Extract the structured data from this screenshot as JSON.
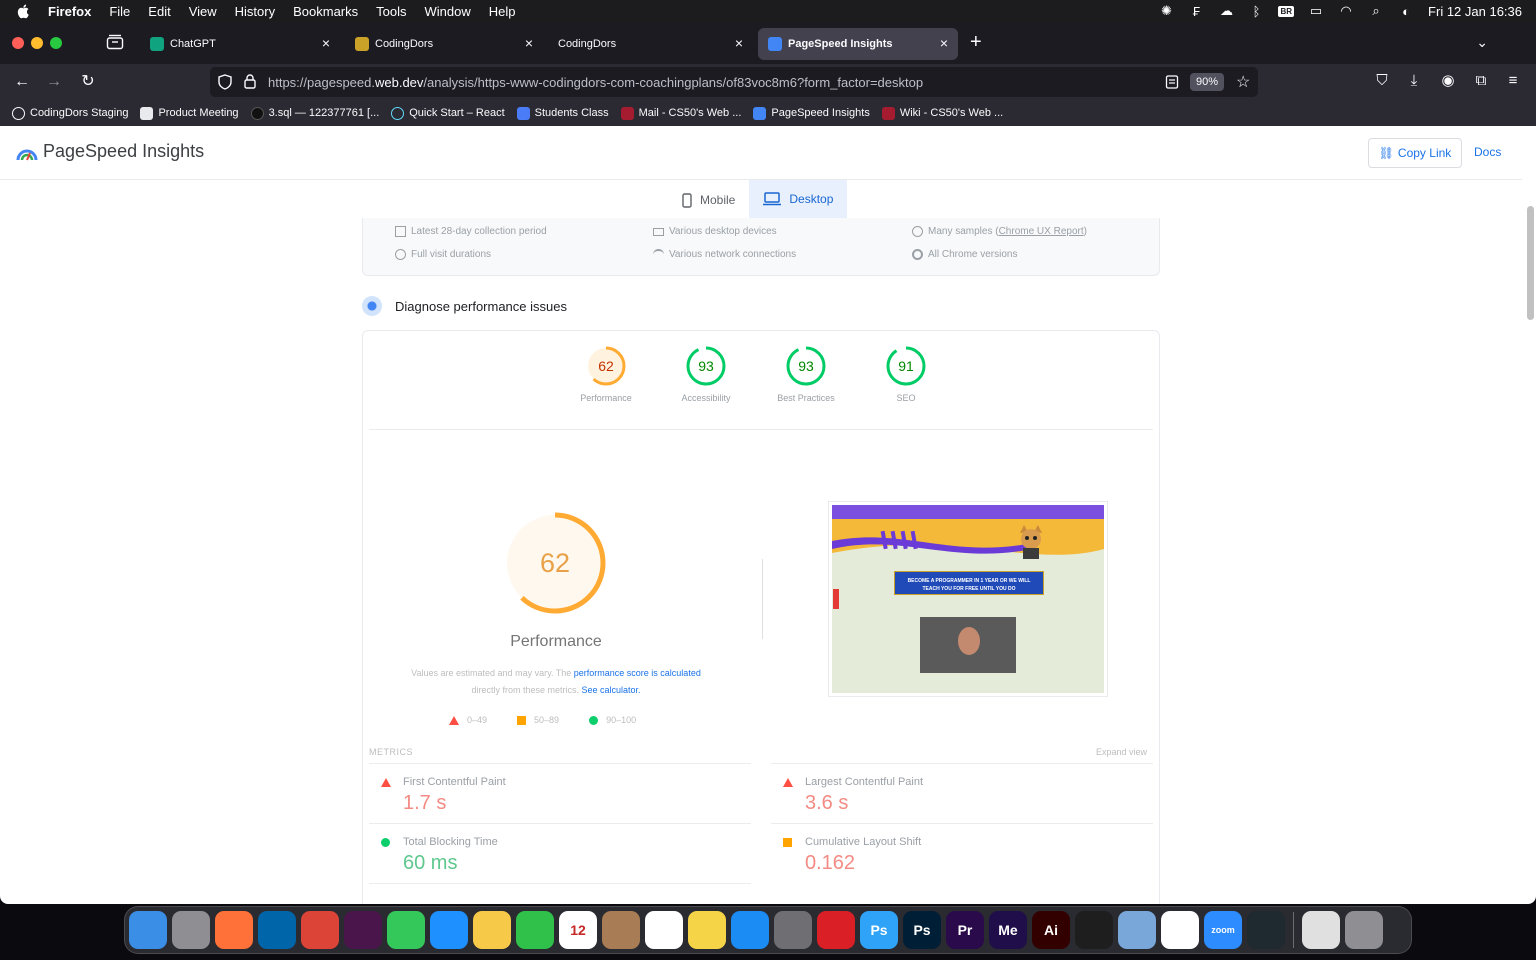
{
  "menubar": {
    "app": "Firefox",
    "menus": [
      "File",
      "Edit",
      "View",
      "History",
      "Bookmarks",
      "Tools",
      "Window",
      "Help"
    ],
    "badge": "BR",
    "clock": "Fri 12 Jan  16:36"
  },
  "tabs": [
    {
      "title": "ChatGPT",
      "favicon_color": "#10a37f",
      "active": false
    },
    {
      "title": "CodingDors",
      "favicon_color": "#c9a227",
      "active": false
    },
    {
      "title": "CodingDors",
      "favicon_color": "",
      "active": false
    },
    {
      "title": "PageSpeed Insights",
      "favicon_color": "#4285f4",
      "active": true
    }
  ],
  "urlbar": {
    "url_prefix": "https://pagespeed.",
    "url_domain": "web.dev",
    "url_path": "/analysis/https-www-codingdors-com-coachingplans/of83voc8m6?form_factor=desktop",
    "zoom": "90%"
  },
  "bookmarks": [
    {
      "label": "CodingDors Staging",
      "icon": "globe-icon",
      "color": "#fbfbfe"
    },
    {
      "label": "Product Meeting",
      "icon": "doc-icon",
      "color": "#e8eaed"
    },
    {
      "label": "3.sql — 122377761 [...",
      "icon": "github-icon",
      "color": "#222"
    },
    {
      "label": "Quick Start – React",
      "icon": "react-icon",
      "color": "#61dafb"
    },
    {
      "label": "Students Class",
      "icon": "k-icon",
      "color": "#4a7cf7"
    },
    {
      "label": "Mail - CS50's Web ...",
      "icon": "harvard-icon",
      "color": "#a51c30"
    },
    {
      "label": "PageSpeed Insights",
      "icon": "pagespeed-icon",
      "color": "#4285f4"
    },
    {
      "label": "Wiki - CS50's Web ...",
      "icon": "harvard-icon",
      "color": "#a51c30"
    }
  ],
  "psi": {
    "title": "PageSpeed Insights",
    "copy_link": "Copy Link",
    "docs": "Docs",
    "device_tabs": {
      "mobile": "Mobile",
      "desktop": "Desktop"
    },
    "field_info": [
      {
        "text": "Latest 28-day collection period",
        "icon": "calendar-icon"
      },
      {
        "text": "Various desktop devices",
        "icon": "desktop-icon"
      },
      {
        "text_pre": "Many samples (",
        "link": "Chrome UX Report",
        "text_post": ")",
        "icon": "samples-icon"
      },
      {
        "text": "Full visit durations",
        "icon": "timer-icon"
      },
      {
        "text": "Various network connections",
        "icon": "wifi-icon"
      },
      {
        "text": "All Chrome versions",
        "icon": "chrome-icon"
      }
    ],
    "diagnose_title": "Diagnose performance issues",
    "scores": [
      {
        "label": "Performance",
        "value": 62,
        "color": "#fa3",
        "text_color": "#c33300",
        "bg": "#fff3e0"
      },
      {
        "label": "Accessibility",
        "value": 93,
        "color": "#0c6",
        "text_color": "#008800",
        "bg": "#e6f8ee"
      },
      {
        "label": "Best Practices",
        "value": 93,
        "color": "#0c6",
        "text_color": "#008800",
        "bg": "#e6f8ee"
      },
      {
        "label": "SEO",
        "value": 91,
        "color": "#0c6",
        "text_color": "#008800",
        "bg": "#e6f8ee"
      }
    ],
    "big_score": {
      "value": 62,
      "label": "Performance"
    },
    "note": {
      "text1": "Values are estimated and may vary. The ",
      "link1": "performance score is calculated",
      "text2": "directly from these metrics. ",
      "link2": "See calculator."
    },
    "legend": [
      "0–49",
      "50–89",
      "90–100"
    ],
    "screenshot": {
      "banner_line1": "BECOME A PROGRAMMER IN 1 YEAR OR WE WILL",
      "banner_line2": "TEACH YOU FOR FREE UNTIL YOU DO"
    },
    "metrics_title": "METRICS",
    "expand_view": "Expand view",
    "metrics": [
      {
        "name": "First Contentful Paint",
        "value": "1.7 s",
        "rating": "bad"
      },
      {
        "name": "Largest Contentful Paint",
        "value": "3.6 s",
        "rating": "bad"
      },
      {
        "name": "Total Blocking Time",
        "value": "60 ms",
        "rating": "good"
      },
      {
        "name": "Cumulative Layout Shift",
        "value": "0.162",
        "rating": "average"
      }
    ]
  },
  "dock": [
    {
      "name": "finder-icon",
      "color": "#3a8ee6",
      "label": ""
    },
    {
      "name": "launchpad-icon",
      "color": "#8e8e93",
      "label": ""
    },
    {
      "name": "firefox-icon",
      "color": "#ff7139",
      "label": ""
    },
    {
      "name": "vscode-icon",
      "color": "#0065a9",
      "label": ""
    },
    {
      "name": "chrome-icon",
      "color": "#db4437",
      "label": ""
    },
    {
      "name": "slack-icon",
      "color": "#4a154b",
      "label": ""
    },
    {
      "name": "messages-icon",
      "color": "#34c759",
      "label": ""
    },
    {
      "name": "mail-icon",
      "color": "#1e90ff",
      "label": ""
    },
    {
      "name": "photos-icon",
      "color": "#f7c948",
      "label": ""
    },
    {
      "name": "facetime-icon",
      "color": "#2fc14a",
      "label": ""
    },
    {
      "name": "calendar-icon",
      "color": "#ffffff",
      "label": "12"
    },
    {
      "name": "contacts-icon",
      "color": "#a87c55",
      "label": ""
    },
    {
      "name": "reminders-icon",
      "color": "#ffffff",
      "label": ""
    },
    {
      "name": "notes-icon",
      "color": "#f5d547",
      "label": ""
    },
    {
      "name": "appstore-icon",
      "color": "#1c8cf5",
      "label": ""
    },
    {
      "name": "settings-icon",
      "color": "#6e6e73",
      "label": ""
    },
    {
      "name": "creative-cloud-icon",
      "color": "#da1f26",
      "label": ""
    },
    {
      "name": "photoshop-express-icon",
      "color": "#2fa3f7",
      "label": "Ps"
    },
    {
      "name": "photoshop-icon",
      "color": "#001e36",
      "label": "Ps"
    },
    {
      "name": "premiere-icon",
      "color": "#2a0a4a",
      "label": "Pr"
    },
    {
      "name": "media-encoder-icon",
      "color": "#1f0e4a",
      "label": "Me"
    },
    {
      "name": "illustrator-icon",
      "color": "#330000",
      "label": "Ai"
    },
    {
      "name": "figma-icon",
      "color": "#1e1e1e",
      "label": ""
    },
    {
      "name": "preview-icon",
      "color": "#7aa7d9",
      "label": ""
    },
    {
      "name": "flower-app-icon",
      "color": "#ffffff",
      "label": ""
    },
    {
      "name": "zoom-icon",
      "color": "#2d8cff",
      "label": "zoom"
    },
    {
      "name": "cursor-app-icon",
      "color": "#1f2a30",
      "label": ""
    },
    {
      "name": "downloads-stack-icon",
      "color": "#e0e0e0",
      "label": ""
    },
    {
      "name": "trash-icon",
      "color": "#8e8e93",
      "label": ""
    }
  ]
}
